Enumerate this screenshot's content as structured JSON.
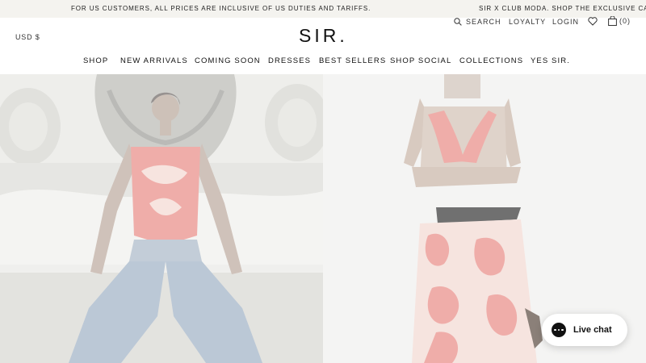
{
  "announcement": {
    "message_1": "FOR US CUSTOMERS, ALL PRICES ARE INCLUSIVE OF US DUTIES AND TARIFFS.",
    "message_2": "SIR x CLUB MODA. SHOP THE EXCLUSIVE CAPSULE"
  },
  "header": {
    "currency": "USD $",
    "logo": "SIR.",
    "search_label": "SEARCH",
    "loyalty_label": "LOYALTY",
    "login_label": "LOGIN",
    "bag_count": "(0)"
  },
  "nav": {
    "items": [
      {
        "label": "SHOP"
      },
      {
        "label": "NEW ARRIVALS"
      },
      {
        "label": "COMING SOON"
      },
      {
        "label": "DRESSES"
      },
      {
        "label": "BEST SELLERS"
      },
      {
        "label": "SHOP SOCIAL"
      },
      {
        "label": "COLLECTIONS"
      },
      {
        "label": "YES SIR."
      }
    ]
  },
  "chat": {
    "label": "Live chat"
  },
  "colors": {
    "announcement_bg": "#f4f3ef",
    "text": "#111111",
    "print_accent": "#e98a84"
  },
  "icons": {
    "search": "search-icon",
    "wishlist": "heart-icon",
    "bag": "bag-icon",
    "chat": "chat-icon"
  }
}
